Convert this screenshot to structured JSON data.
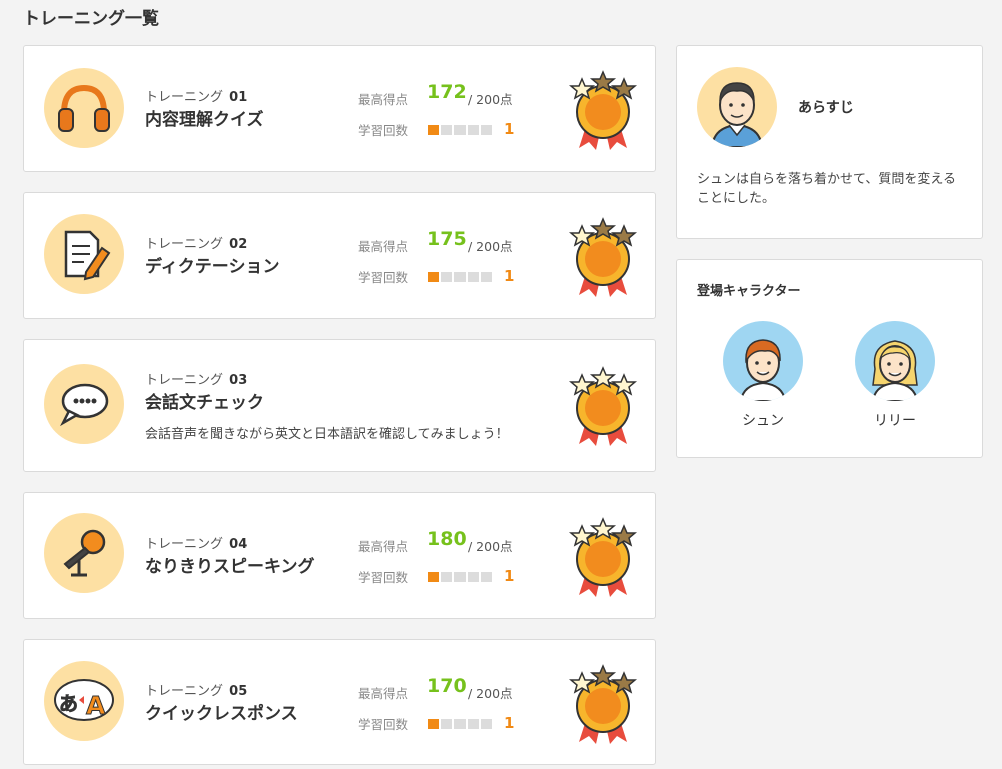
{
  "page": {
    "title": "トレーニング一覧"
  },
  "trainings": [
    {
      "prefix": "トレーニング",
      "number": "01",
      "name": "内容理解クイズ",
      "score_label": "最高得点",
      "score": "172",
      "max": "/ 200点",
      "count_label": "学習回数",
      "count": "1",
      "icon": "headphones-icon"
    },
    {
      "prefix": "トレーニング",
      "number": "02",
      "name": "ディクテーション",
      "score_label": "最高得点",
      "score": "175",
      "max": "/ 200点",
      "count_label": "学習回数",
      "count": "1",
      "icon": "notepad-pencil-icon"
    },
    {
      "prefix": "トレーニング",
      "number": "03",
      "name": "会話文チェック",
      "description": "会話音声を聞きながら英文と日本語訳を確認してみましょう！",
      "icon": "speech-bubble-icon"
    },
    {
      "prefix": "トレーニング",
      "number": "04",
      "name": "なりきりスピーキング",
      "score_label": "最高得点",
      "score": "180",
      "max": "/ 200点",
      "count_label": "学習回数",
      "count": "1",
      "icon": "microphone-icon"
    },
    {
      "prefix": "トレーニング",
      "number": "05",
      "name": "クイックレスポンス",
      "score_label": "最高得点",
      "score": "170",
      "max": "/ 200点",
      "count_label": "学習回数",
      "count": "1",
      "icon": "translate-icon"
    }
  ],
  "synopsis": {
    "heading": "あらすじ",
    "text": "シュンは自らを落ち着かせて、質問を変えることにした。"
  },
  "characters": {
    "heading": "登場キャラクター",
    "items": [
      {
        "name": "シュン"
      },
      {
        "name": "リリー"
      }
    ]
  },
  "colors": {
    "score_green": "#76c11c",
    "accent_orange": "#f18a15",
    "icon_bg": "#fde0a3"
  }
}
